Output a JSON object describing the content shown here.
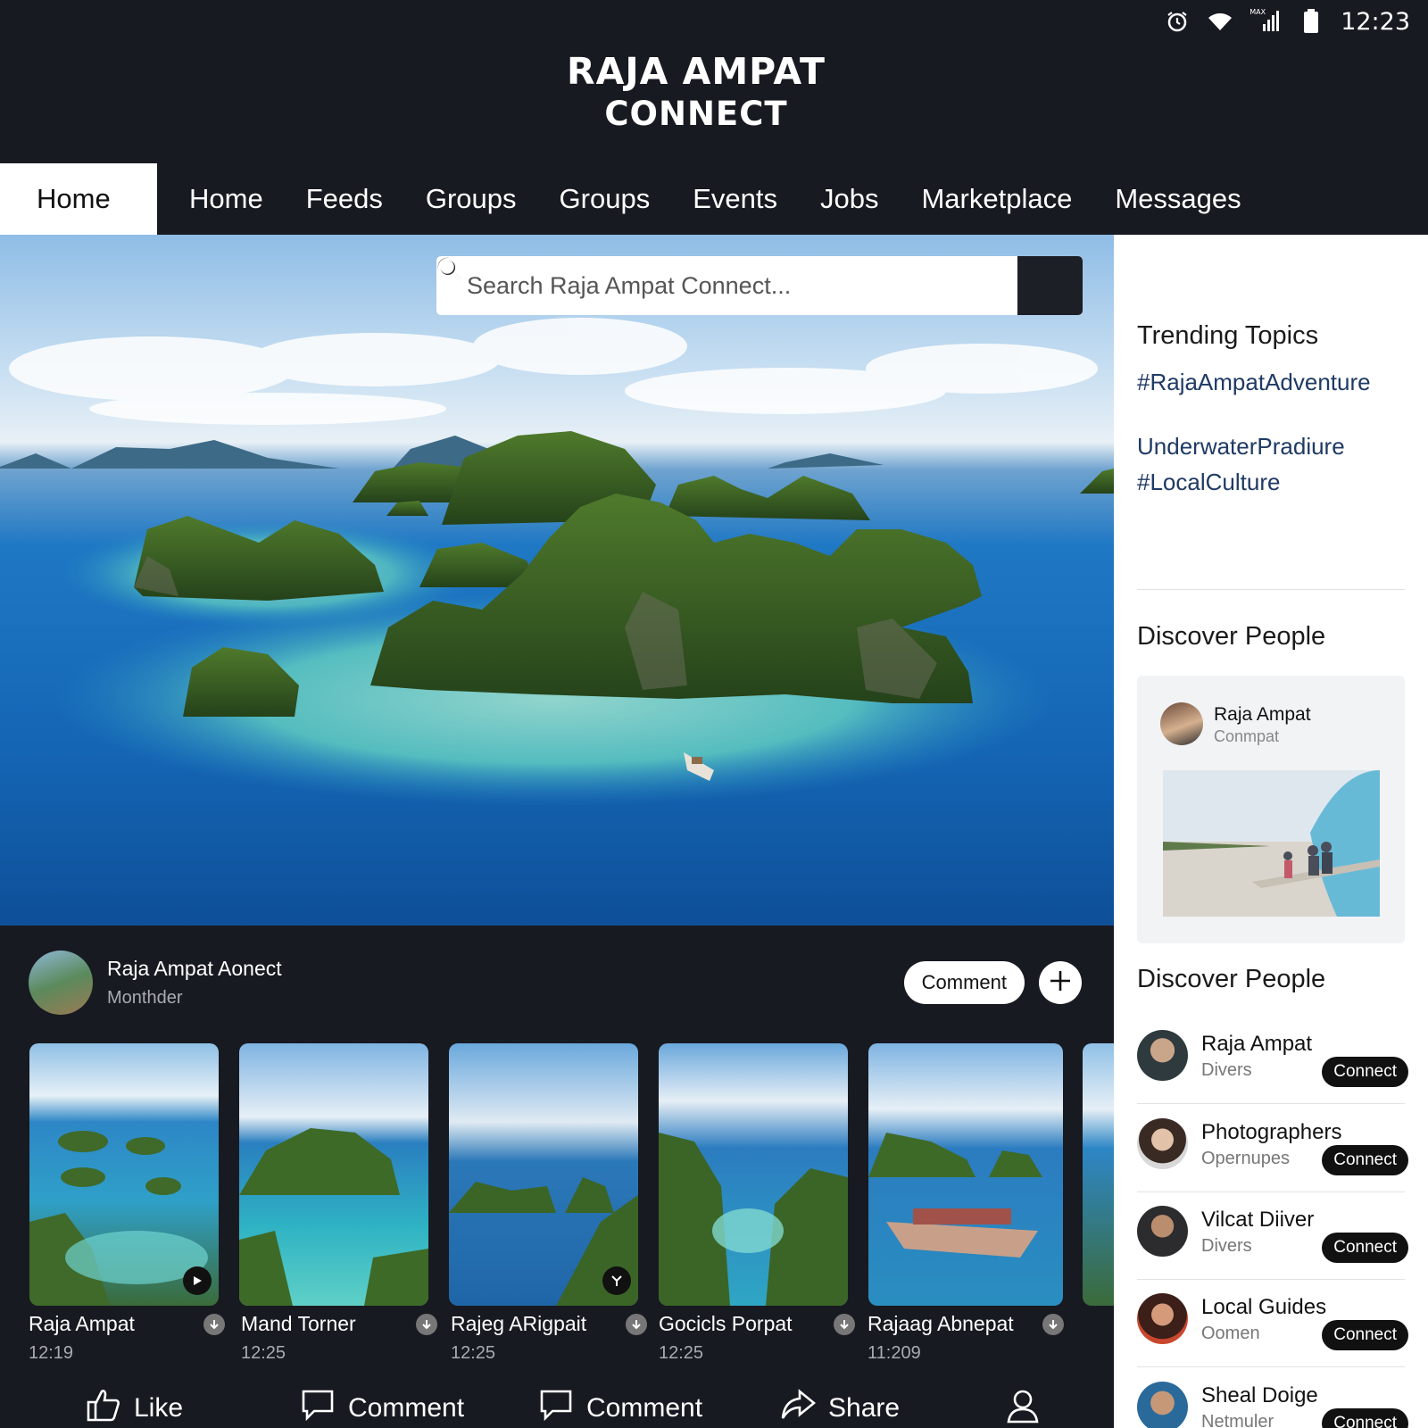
{
  "status_bar": {
    "icons": [
      "alarm-icon",
      "wifi-icon",
      "signal-icon",
      "battery-icon"
    ],
    "signal_label": "MAX",
    "time": "12:23"
  },
  "brand": {
    "line1": "RAJA AMPAT",
    "line2": "CONNECT"
  },
  "nav": {
    "tabs": [
      {
        "label": "Home",
        "active": true
      },
      {
        "label": "Home"
      },
      {
        "label": "Feeds"
      },
      {
        "label": "Groups"
      },
      {
        "label": "Groups"
      },
      {
        "label": "Events"
      },
      {
        "label": "Jobs"
      },
      {
        "label": "Marketplace"
      },
      {
        "label": "Messages"
      }
    ]
  },
  "search": {
    "placeholder": "Search Raja Ampat Connect..."
  },
  "post": {
    "author": "Raja Ampat Aonect",
    "subtitle": "Monthder",
    "comment_label": "Comment"
  },
  "thumbnails": [
    {
      "title": "Raja Ampat",
      "time": "12:19",
      "overlay": "play-icon"
    },
    {
      "title": "Mand Torner",
      "time": "12:25"
    },
    {
      "title": "Rajeg ARigpait",
      "time": "12:25",
      "overlay": "tool-icon"
    },
    {
      "title": "Gocicls Porpat",
      "time": "12:25"
    },
    {
      "title": "Rajaag Abnepat",
      "time": "11:209"
    }
  ],
  "action_bar": {
    "like": "Like",
    "comment1": "Comment",
    "comment2": "Comment",
    "share": "Share"
  },
  "sidebar": {
    "trending_title": "Trending Topics",
    "trending": [
      "#RajaAmpatAdventure",
      "UnderwaterPradiure",
      "#LocalCulture"
    ],
    "discover_title_1": "Discover People",
    "featured": {
      "name": "Raja Ampat",
      "subtitle": "Conmpat"
    },
    "discover_title_2": "Discover People",
    "people": [
      {
        "name": "Raja Ampat",
        "role": "Divers",
        "button": "Connect"
      },
      {
        "name": "Photographers",
        "role": "Opernupes",
        "button": "Connect"
      },
      {
        "name": "Vilcat Diiver",
        "role": "Divers",
        "button": "Connect"
      },
      {
        "name": "Local Guides",
        "role": "Oomen",
        "button": "Connect"
      },
      {
        "name": "Sheal Doige",
        "role": "Netmuler",
        "button": "Connect"
      }
    ]
  },
  "colors": {
    "dark_bg": "#181a21",
    "accent_link": "#1f3a64",
    "sidebar_bg": "#ffffff"
  }
}
